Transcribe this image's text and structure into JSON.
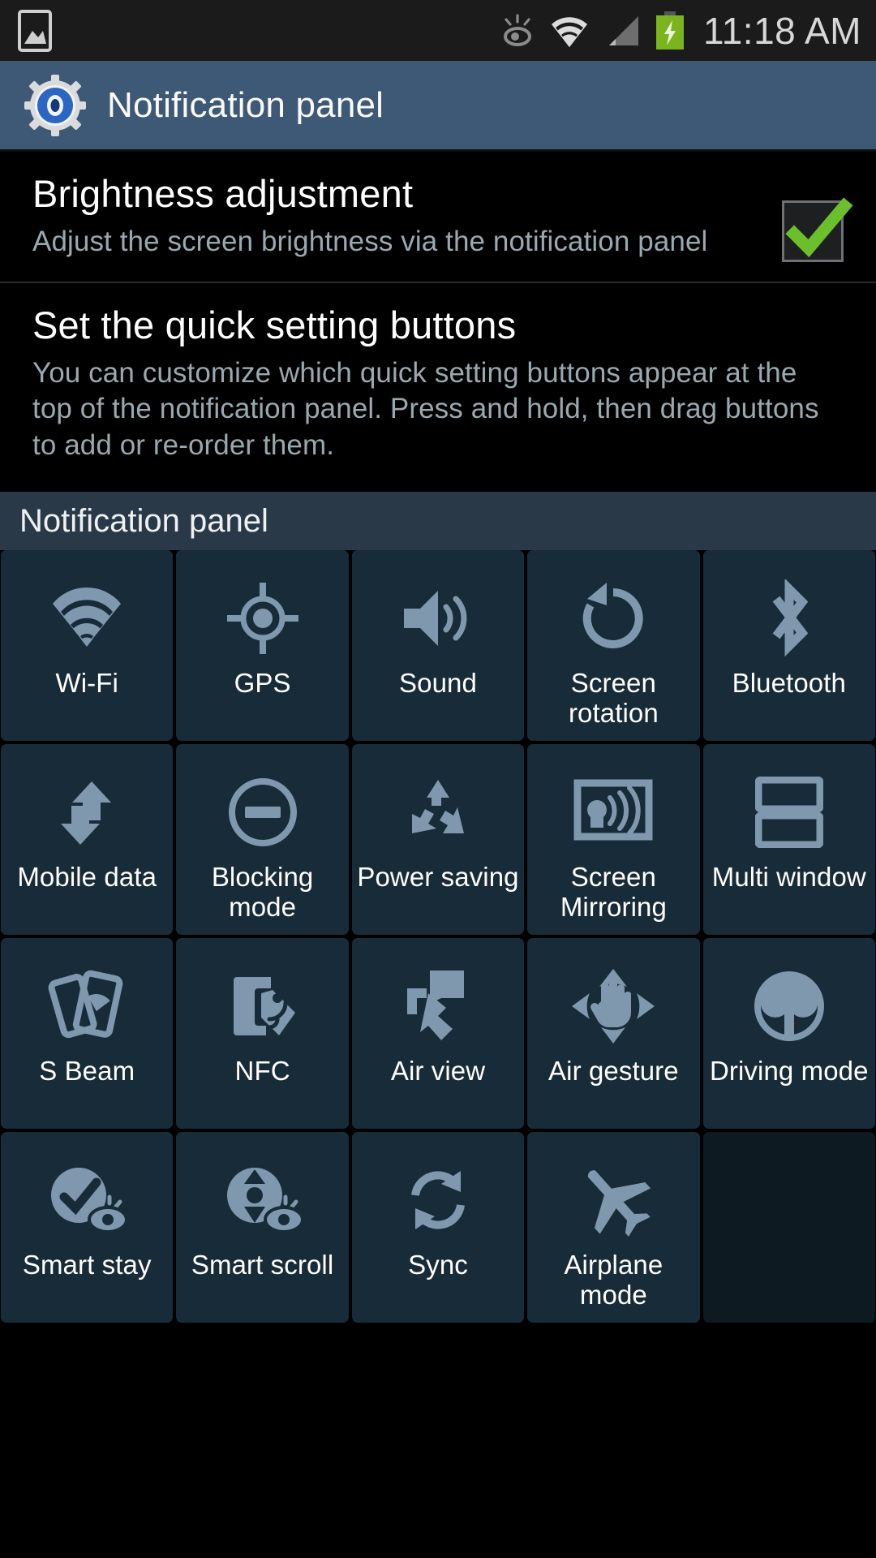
{
  "statusbar": {
    "time": "11:18 AM",
    "icons": [
      "image-icon",
      "smart-stay-eye-icon",
      "wifi-signal-icon",
      "cellular-signal-icon",
      "battery-charging-icon"
    ]
  },
  "actionbar": {
    "icon": "settings-gear-icon",
    "title": "Notification panel"
  },
  "preferences": [
    {
      "title": "Brightness adjustment",
      "summary": "Adjust the screen brightness via the notification panel",
      "checked": true,
      "checkbox_color": "#6abf2a"
    },
    {
      "title": "Set the quick setting buttons",
      "summary": "You can customize which quick setting buttons appear at the top of the notification panel. Press and hold, then drag buttons to add or re-order them."
    }
  ],
  "section": {
    "header": "Notification panel"
  },
  "grid": {
    "tiles": [
      {
        "label": "Wi-Fi",
        "icon": "wifi-icon"
      },
      {
        "label": "GPS",
        "icon": "gps-icon"
      },
      {
        "label": "Sound",
        "icon": "sound-icon"
      },
      {
        "label": "Screen rotation",
        "icon": "screen-rotation-icon"
      },
      {
        "label": "Bluetooth",
        "icon": "bluetooth-icon"
      },
      {
        "label": "Mobile data",
        "icon": "mobile-data-icon"
      },
      {
        "label": "Blocking mode",
        "icon": "blocking-mode-icon"
      },
      {
        "label": "Power saving",
        "icon": "power-saving-icon"
      },
      {
        "label": "Screen Mirroring",
        "icon": "screen-mirroring-icon"
      },
      {
        "label": "Multi window",
        "icon": "multi-window-icon"
      },
      {
        "label": "S Beam",
        "icon": "s-beam-icon"
      },
      {
        "label": "NFC",
        "icon": "nfc-icon"
      },
      {
        "label": "Air view",
        "icon": "air-view-icon"
      },
      {
        "label": "Air gesture",
        "icon": "air-gesture-icon"
      },
      {
        "label": "Driving mode",
        "icon": "driving-mode-icon"
      },
      {
        "label": "Smart stay",
        "icon": "smart-stay-icon"
      },
      {
        "label": "Smart scroll",
        "icon": "smart-scroll-icon"
      },
      {
        "label": "Sync",
        "icon": "sync-icon"
      },
      {
        "label": "Airplane mode",
        "icon": "airplane-mode-icon"
      },
      {
        "label": "",
        "icon": "empty-slot"
      }
    ],
    "icon_color": "#7f98ad"
  },
  "colors": {
    "actionbar_bg": "#3d5975",
    "section_bg": "#2a3948",
    "tile_bg": "#182b38",
    "page_bg": "#000000",
    "summary_text": "#9aa8b0"
  }
}
